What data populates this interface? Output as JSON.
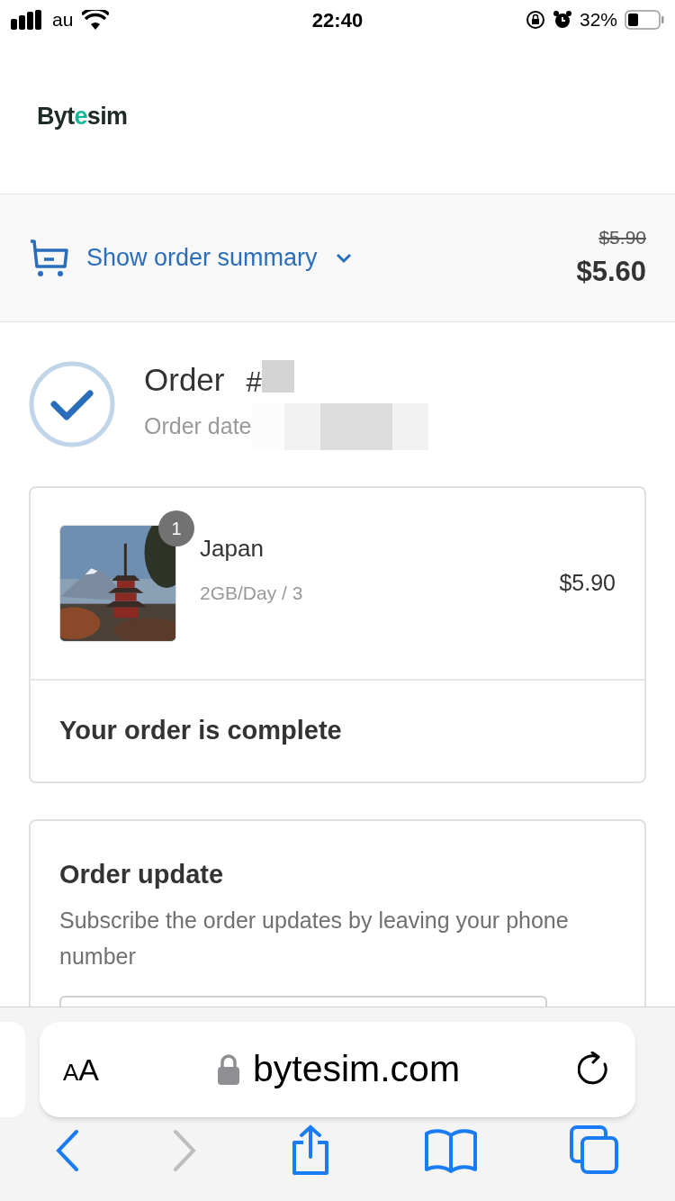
{
  "status_bar": {
    "carrier": "au",
    "time": "22:40",
    "battery": "32%"
  },
  "logo": {
    "lead": "Byt",
    "accent": "e",
    "tail": "sim"
  },
  "summary": {
    "label": "Show order summary",
    "expanded": false,
    "original_price": "$5.90",
    "price": "$5.60"
  },
  "order": {
    "title": "Order",
    "number_prefix": "#",
    "date_label": "Order date",
    "confirmed": true
  },
  "items": [
    {
      "name": "Japan",
      "variant": "2GB/Day / 3",
      "quantity": "1",
      "price": "$5.90"
    }
  ],
  "status_message": "Your order is complete",
  "order_update": {
    "title": "Order update",
    "description": "Subscribe the order updates by leaving your phone number"
  },
  "browser": {
    "text_size": "AA",
    "url": "bytesim.com",
    "back_enabled": true,
    "forward_enabled": false
  }
}
